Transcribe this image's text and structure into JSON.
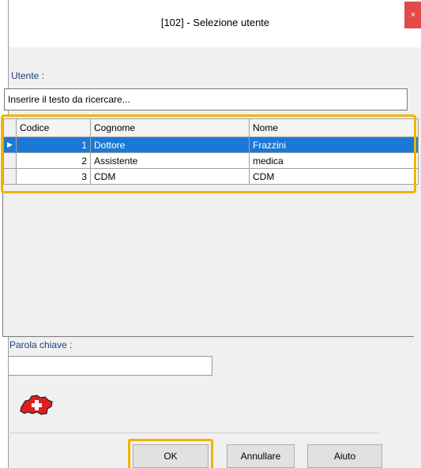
{
  "window": {
    "title": "[102] - Selezione utente",
    "close_glyph": "×"
  },
  "user_section": {
    "label": "Utente :",
    "search_value": "Inserire il testo da ricercare..."
  },
  "grid": {
    "columns": [
      "Codice",
      "Cognome",
      "Nome"
    ],
    "selected_row": 0,
    "rows": [
      {
        "codice": "1",
        "cognome": "Dottore",
        "nome": "Frazzini"
      },
      {
        "codice": "2",
        "cognome": "Assistente",
        "nome": "medica"
      },
      {
        "codice": "3",
        "cognome": "CDM",
        "nome": "CDM"
      }
    ],
    "row_indicator": "▶"
  },
  "keyword": {
    "label": "Parola chiave :",
    "value": ""
  },
  "icon": {
    "name": "swiss-flag-icon",
    "color": "#e02020"
  },
  "buttons": {
    "ok": "OK",
    "cancel": "Annullare",
    "help": "Aiuto"
  },
  "colors": {
    "highlight": "#f0b400",
    "selection": "#1c78d6",
    "label": "#1f3f7a"
  }
}
